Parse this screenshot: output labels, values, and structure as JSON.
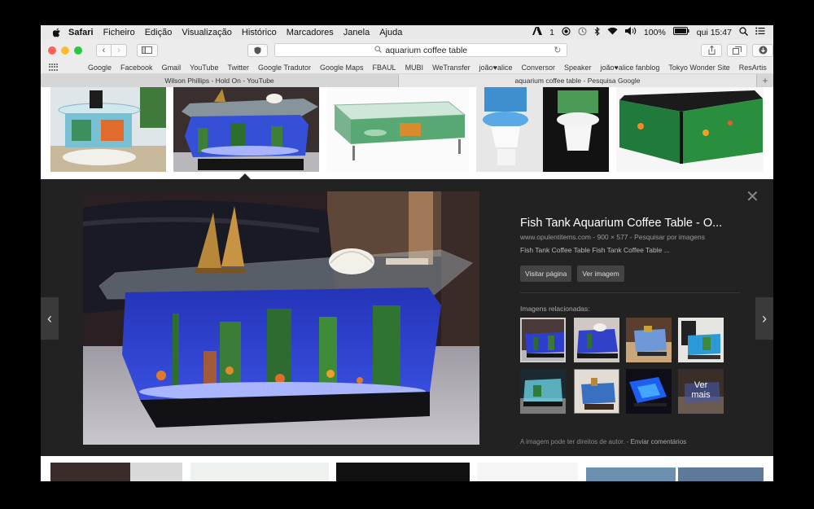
{
  "menubar": {
    "app": "Safari",
    "items": [
      "Ficheiro",
      "Edição",
      "Visualização",
      "Histórico",
      "Marcadores",
      "Janela",
      "Ajuda"
    ],
    "status_one": "1",
    "battery": "100%",
    "clock": "qui 15:47"
  },
  "toolbar": {
    "address": "aquarium coffee table"
  },
  "bookmarks": [
    "Google",
    "Facebook",
    "Gmail",
    "YouTube",
    "Twitter",
    "Google Tradutor",
    "Google Maps",
    "FBAUL",
    "MUBI",
    "WeTransfer",
    "joão♥alice",
    "Conversor",
    "Speaker",
    "joão♥alice fanblog",
    "Tokyo Wonder Site",
    "ResArtis"
  ],
  "tabs": [
    {
      "title": "Wilson Phillips - Hold On - YouTube"
    },
    {
      "title": "aquarium coffee table - Pesquisa Google"
    }
  ],
  "detail": {
    "title": "Fish Tank Aquarium Coffee Table - O...",
    "source": "www.opulentitems.com - 900 × 577 - Pesquisar por imagens",
    "description": "Fish Tank Coffee Table Fish Tank Coffee Table ...",
    "visit_label": "Visitar página",
    "view_label": "Ver imagem",
    "related_label": "Imagens relacionadas:",
    "more_line1": "Ver",
    "more_line2": "mais",
    "copyright": "A imagem pode ter direitos de autor.",
    "separator": "-",
    "feedback": "Enviar comentários"
  },
  "colors": {
    "close": "#ff5f57",
    "minimize": "#febc2e",
    "zoom": "#28c840",
    "panel_bg": "#222222",
    "aquarium_blue": "#2d3dcc"
  }
}
